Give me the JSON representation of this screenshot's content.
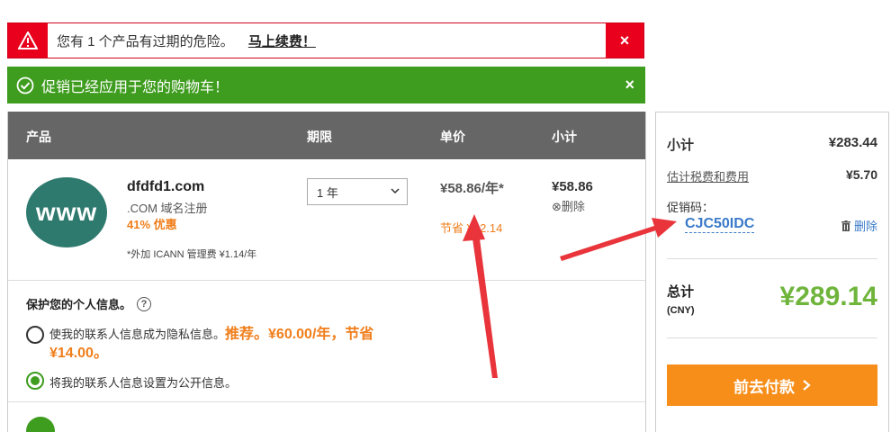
{
  "alerts": {
    "danger": {
      "message": "您有 1 个产品有过期的危险。",
      "action": "马上续费！",
      "close": "×"
    },
    "success": {
      "message": "促销已经应用于您的购物车！",
      "close": "×"
    }
  },
  "cart": {
    "headers": [
      "产品",
      "期限",
      "单价",
      "小计"
    ],
    "item": {
      "badge": "www",
      "name": "dfdfd1.com",
      "type": ".COM 域名注册",
      "discount": "41% 优惠",
      "fee_note": "*外加 ICANN 管理费 ¥1.14/年",
      "term": "1 年",
      "unit_price": "¥58.86/年*",
      "saving": "节省 ¥42.14",
      "subtotal": "¥58.86",
      "remove": "⊗删除"
    },
    "privacy": {
      "title": "保护您的个人信息。",
      "help": "?",
      "option_private_prefix": "使我的联系人信息成为隐私信息。",
      "option_private_highlight": "推荐。¥60.00/年，节省 ¥14.00。",
      "option_public": "将我的联系人信息设置为公开信息。",
      "selected": "public"
    }
  },
  "summary": {
    "subtotal_label": "小计",
    "subtotal_value": "¥283.44",
    "tax_label": "估计税费和费用",
    "tax_value": "¥5.70",
    "promo_label": "促销码：",
    "promo_code": "CJC50IDC",
    "promo_remove": "删除",
    "total_label": "总计",
    "total_currency": "(CNY)",
    "total_value": "¥289.14",
    "checkout_label": "前去付款"
  },
  "colors": {
    "danger": "#e8001c",
    "success": "#3e9c1e",
    "accent_orange": "#f78e1a",
    "link_blue": "#3a7ac8",
    "total_green": "#6fb53c",
    "header_gray": "#666666",
    "annotation_red": "#e8343a"
  }
}
